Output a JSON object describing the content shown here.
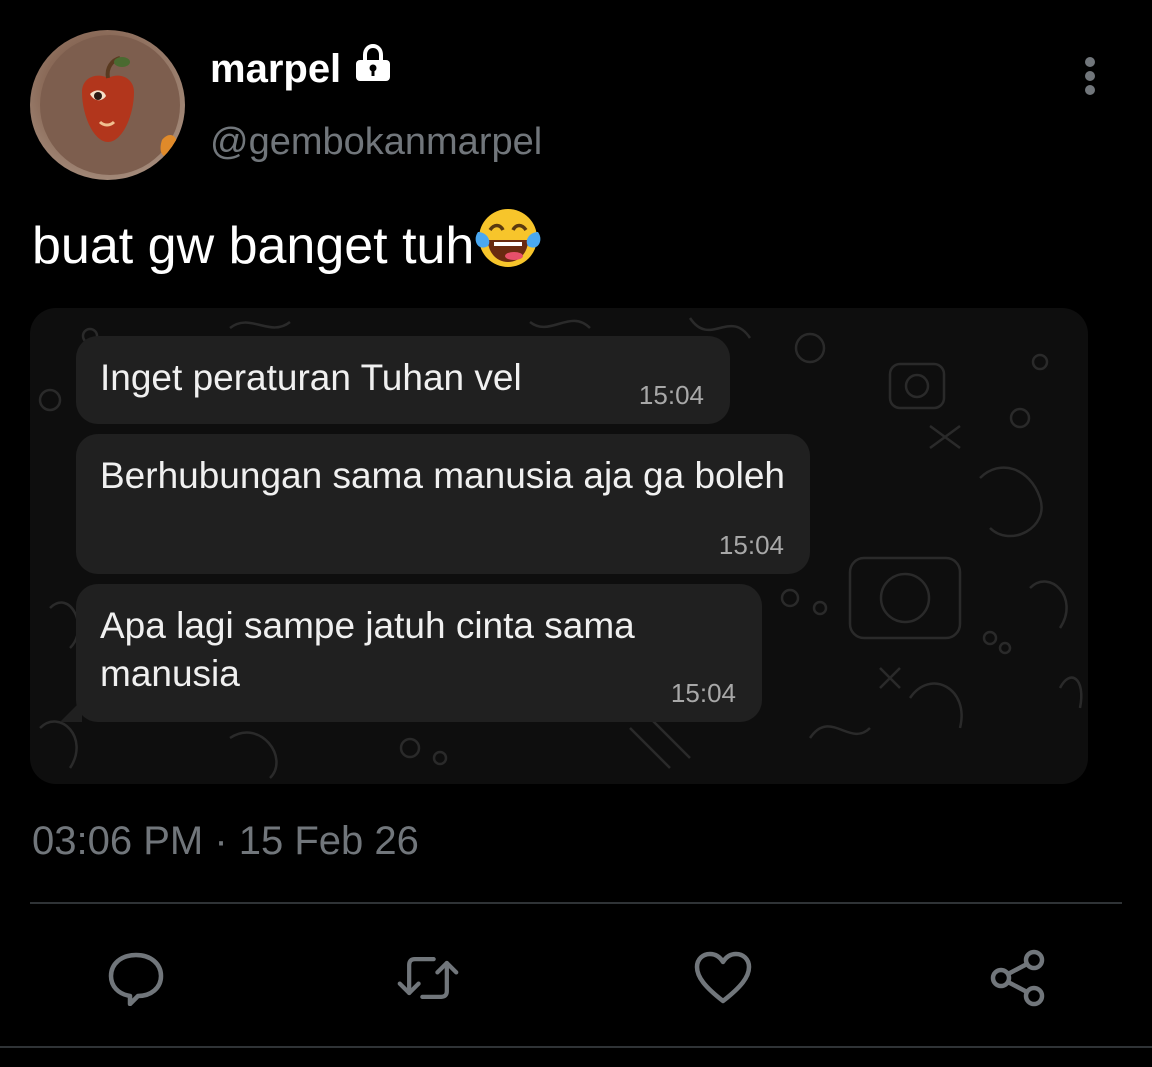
{
  "author": {
    "display_name": "marpel",
    "handle": "@gembokanmarpel",
    "locked": true,
    "avatar_icon": "avatar-icon"
  },
  "tweet": {
    "text": "buat gw banget tuh",
    "emoji": "face-with-tears-of-joy"
  },
  "media": {
    "messages": [
      {
        "text": "Inget peraturan Tuhan vel",
        "time": "15:04"
      },
      {
        "text": "Berhubungan sama manusia aja ga boleh",
        "time": "15:04"
      },
      {
        "text": "Apa lagi sampe jatuh cinta sama manusia",
        "time": "15:04"
      }
    ]
  },
  "timestamp": "03:06 PM · 15 Feb 26",
  "actions": [
    {
      "name": "reply",
      "icon": "reply-icon"
    },
    {
      "name": "retweet",
      "icon": "retweet-icon"
    },
    {
      "name": "like",
      "icon": "heart-icon"
    },
    {
      "name": "share",
      "icon": "share-icon"
    }
  ],
  "colors": {
    "background": "#000000",
    "text_primary": "#e7e9ea",
    "text_secondary": "#71767b",
    "divider": "#2f3336",
    "bubble": "#202020"
  }
}
